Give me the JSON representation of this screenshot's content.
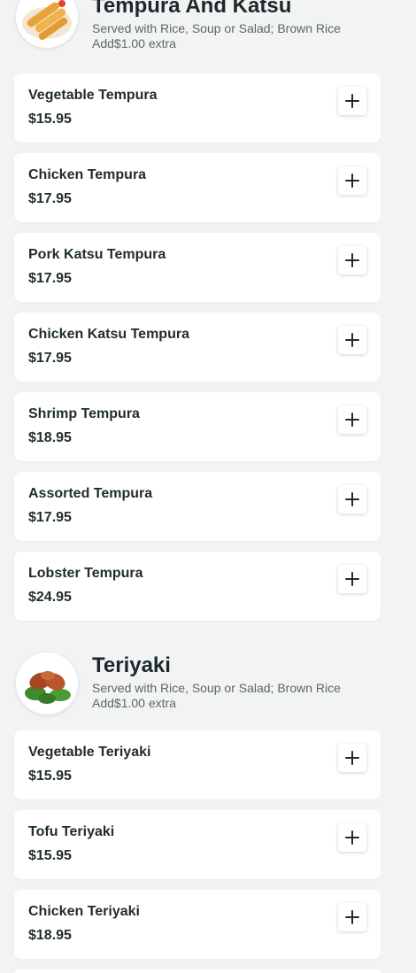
{
  "sections": [
    {
      "title": "Tempura And Katsu",
      "description": "Served with Rice, Soup or Salad; Brown Rice Add$1.00 extra",
      "image_icon": "shrimp-tempura-image",
      "items": [
        {
          "name": "Vegetable Tempura",
          "price": "$15.95"
        },
        {
          "name": "Chicken Tempura",
          "price": "$17.95"
        },
        {
          "name": "Pork Katsu Tempura",
          "price": "$17.95"
        },
        {
          "name": "Chicken Katsu Tempura",
          "price": "$17.95"
        },
        {
          "name": "Shrimp Tempura",
          "price": "$18.95"
        },
        {
          "name": "Assorted Tempura",
          "price": "$17.95"
        },
        {
          "name": "Lobster Tempura",
          "price": "$24.95"
        }
      ]
    },
    {
      "title": "Teriyaki",
      "description": "Served with Rice, Soup or Salad; Brown Rice Add$1.00 extra",
      "image_icon": "chicken-teriyaki-image",
      "items": [
        {
          "name": "Vegetable Teriyaki",
          "price": "$15.95"
        },
        {
          "name": "Tofu Teriyaki",
          "price": "$15.95"
        },
        {
          "name": "Chicken Teriyaki",
          "price": "$18.95"
        }
      ]
    }
  ],
  "colors": {
    "background": "#f2f3f5",
    "card": "#ffffff",
    "text": "#1f2d2b",
    "muted": "#5d6664"
  },
  "icons": {
    "add": "plus-icon"
  }
}
